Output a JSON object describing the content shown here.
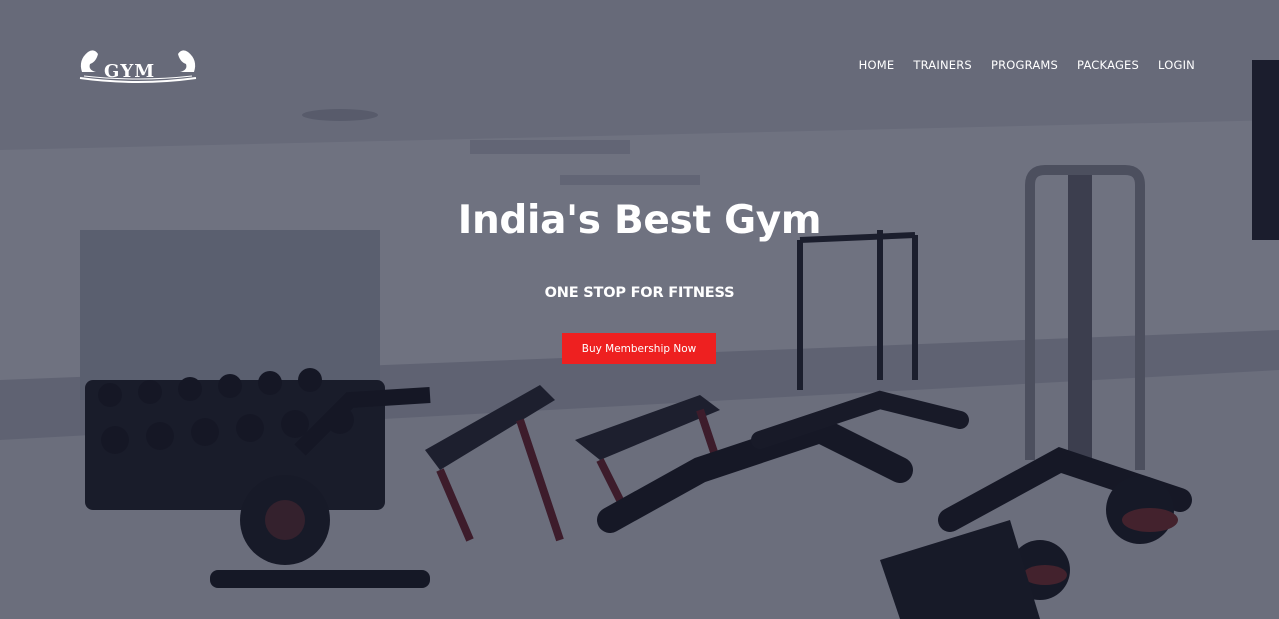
{
  "logo": {
    "text": "GYM"
  },
  "nav": {
    "items": [
      {
        "label": "HOME"
      },
      {
        "label": "TRAINERS"
      },
      {
        "label": "PROGRAMS"
      },
      {
        "label": "PACKAGES"
      },
      {
        "label": "LOGIN"
      }
    ]
  },
  "hero": {
    "title": "India's Best Gym",
    "subtitle": "ONE STOP FOR FITNESS",
    "cta_label": "Buy Membership Now",
    "colors": {
      "accent": "#ee2020",
      "overlay": "#161930",
      "text": "#ffffff"
    }
  }
}
